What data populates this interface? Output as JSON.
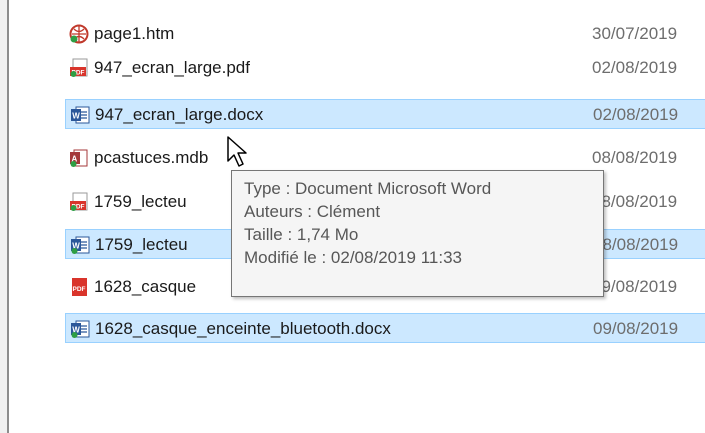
{
  "files": [
    {
      "name": "page1.htm",
      "date": "30/07/2019",
      "icon": "html-icon",
      "selected": false
    },
    {
      "name": "947_ecran_large.pdf",
      "date": "02/08/2019",
      "icon": "pdf-icon",
      "selected": false
    },
    {
      "name": "947_ecran_large.docx",
      "date": "02/08/2019",
      "icon": "word-icon",
      "selected": true
    },
    {
      "name": "pcastuces.mdb",
      "date": "08/08/2019",
      "icon": "access-icon",
      "selected": false
    },
    {
      "name": "1759_lecteu",
      "date": "08/08/2019",
      "icon": "pdf-icon",
      "selected": false
    },
    {
      "name": "1759_lecteu",
      "date": "08/08/2019",
      "icon": "word-icon",
      "selected": true
    },
    {
      "name": "1628_casque",
      "date": "09/08/2019",
      "icon": "pdf-icon",
      "selected": false
    },
    {
      "name": "1628_casque_enceinte_bluetooth.docx",
      "date": "09/08/2019",
      "icon": "word-icon",
      "selected": true
    }
  ],
  "tooltip": {
    "type": "Type : Document Microsoft Word",
    "authors": "Auteurs : Clément",
    "size": "Taille : 1,74 Mo",
    "modified": "Modifié le : 02/08/2019 11:33"
  },
  "colors": {
    "selection": "#cce8ff",
    "selection_border": "#99d1ff",
    "date_text": "#6d6d6d",
    "tooltip_bg": "#f5f5f5"
  }
}
